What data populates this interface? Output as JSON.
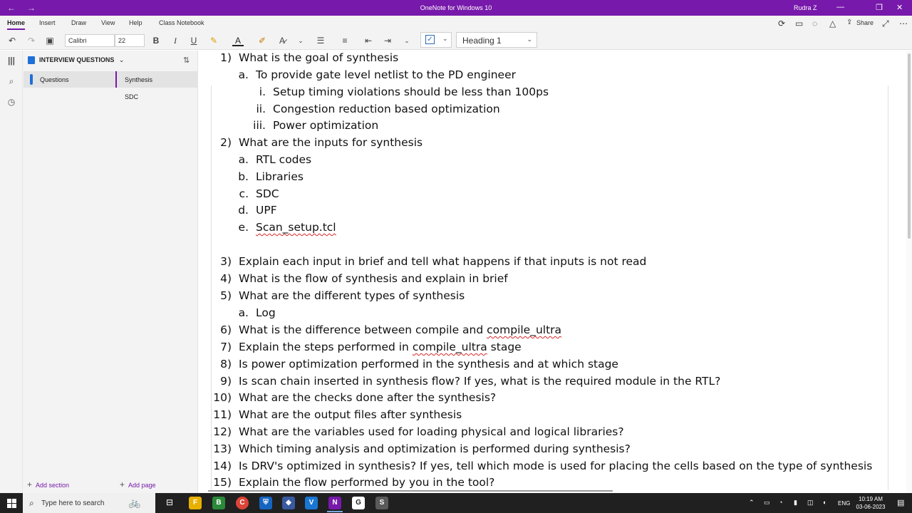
{
  "window": {
    "title": "OneNote for Windows 10",
    "user": "Rudra Z",
    "back": "←",
    "forward": "→",
    "minimize": "—",
    "maximize": "❐",
    "close": "✕"
  },
  "ribbon": {
    "tabs": [
      "Home",
      "Insert",
      "Draw",
      "View",
      "Help",
      "Class Notebook"
    ],
    "active_tab": "Home",
    "font_name": "Calibri",
    "font_size": "22",
    "bold": "B",
    "italic": "I",
    "underline": "U",
    "style": "Heading 1",
    "share": "Share"
  },
  "notebook": {
    "name": "INTERVIEW QUESTIONS",
    "section": "Questions",
    "pages": [
      "Synthesis",
      "SDC"
    ],
    "selected_page": "Synthesis",
    "add_section": "Add section",
    "add_page": "Add page"
  },
  "note": {
    "lines": [
      {
        "num": "1)",
        "text": "What is the goal of synthesis"
      },
      {
        "num": "a.",
        "text": "To provide gate level netlist to the PD engineer"
      },
      {
        "num": "i.",
        "text": "Setup timing violations should be less than 100ps"
      },
      {
        "num": "ii.",
        "text": "Congestion reduction based optimization"
      },
      {
        "num": "iii.",
        "text": "Power optimization"
      },
      {
        "num": "2)",
        "text": "What are the inputs for synthesis"
      },
      {
        "num": "a.",
        "text": "RTL codes"
      },
      {
        "num": "b.",
        "text": "Libraries"
      },
      {
        "num": "c.",
        "text": "SDC"
      },
      {
        "num": "d.",
        "text": "UPF"
      },
      {
        "num": "e.",
        "text": "Scan_setup.tcl"
      },
      {
        "num": "3)",
        "text": "Explain each input in brief and tell what happens if that inputs is not read"
      },
      {
        "num": "4)",
        "text": "What is the flow of synthesis and explain in brief"
      },
      {
        "num": "5)",
        "text": "What are the different types of synthesis"
      },
      {
        "num": "a.",
        "text": "Log"
      },
      {
        "num": "6)",
        "text_pre": "What is the difference between compile and ",
        "text_flag": "compile_ultra",
        "text_post": ""
      },
      {
        "num": "7)",
        "text_pre": "Explain the steps performed in ",
        "text_flag": "compile_ultra",
        "text_post": " stage"
      },
      {
        "num": "8)",
        "text": "Is power optimization performed in the synthesis and at which stage"
      },
      {
        "num": "9)",
        "text": "Is scan chain inserted in synthesis flow? If yes, what is the required module in the RTL?"
      },
      {
        "num": "10)",
        "text": "What are the checks done after the synthesis?"
      },
      {
        "num": "11)",
        "text": "What are the output files after synthesis"
      },
      {
        "num": "12)",
        "text": "What are the variables used for loading physical and logical libraries?"
      },
      {
        "num": "13)",
        "text": "Which timing analysis and optimization is performed during synthesis?"
      },
      {
        "num": "14)",
        "text": "Is DRV's optimized in synthesis? If yes, tell which mode is used for placing the cells based on the type of synthesis"
      },
      {
        "num": "15)",
        "text": "Explain the flow performed by you in the tool?"
      }
    ]
  },
  "taskbar": {
    "search_placeholder": "Type here to search",
    "language": "ENG",
    "time": "10:19 AM",
    "date": "03-06-2023",
    "apps": [
      "F",
      "B",
      "C",
      "V",
      "N",
      "G",
      "S"
    ]
  },
  "colors": {
    "accent": "#7719aa",
    "taskbar": "#202020",
    "spellcheck": "#d62828"
  }
}
